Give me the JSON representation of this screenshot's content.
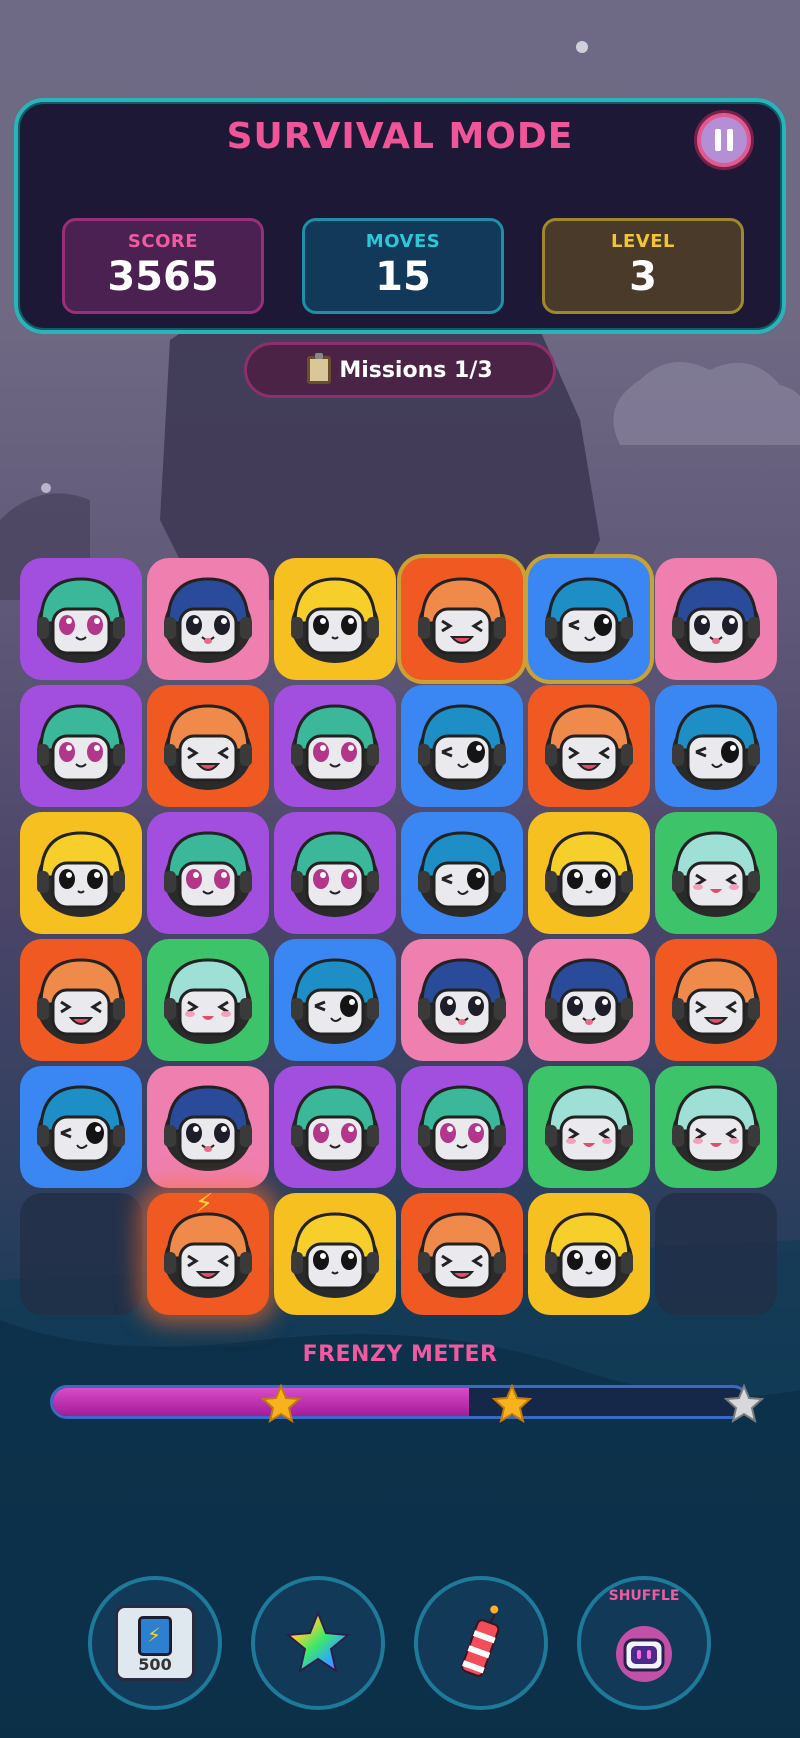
{
  "header": {
    "title": "SURVIVAL MODE",
    "pause_icon": "pause-icon"
  },
  "stats": {
    "score_label": "SCORE",
    "score_value": "3565",
    "moves_label": "MOVES",
    "moves_value": "15",
    "level_label": "LEVEL",
    "level_value": "3"
  },
  "missions": {
    "icon": "clipboard-icon",
    "label": "Missions 1/3"
  },
  "board": {
    "rows": 6,
    "cols": 6,
    "tile_colors": {
      "purple": "#a24fe0",
      "pink": "#ef7fae",
      "yellow": "#f6c020",
      "orange": "#f05a22",
      "blue": "#3a86f2",
      "green": "#3dc46a",
      "empty": "#2a3555"
    },
    "tiles": [
      [
        {
          "color": "purple",
          "face": "green-bolt"
        },
        {
          "color": "pink",
          "face": "navy-sparkle"
        },
        {
          "color": "yellow",
          "face": "yellow-cute"
        },
        {
          "color": "orange",
          "face": "orange-laugh",
          "state": "selected"
        },
        {
          "color": "blue",
          "face": "teal-wink",
          "state": "selected"
        },
        {
          "color": "pink",
          "face": "navy-sparkle"
        }
      ],
      [
        {
          "color": "purple",
          "face": "green-bolt"
        },
        {
          "color": "orange",
          "face": "orange-laugh"
        },
        {
          "color": "purple",
          "face": "green-bolt"
        },
        {
          "color": "blue",
          "face": "teal-wink"
        },
        {
          "color": "orange",
          "face": "orange-laugh"
        },
        {
          "color": "blue",
          "face": "teal-wink"
        }
      ],
      [
        {
          "color": "yellow",
          "face": "yellow-cute"
        },
        {
          "color": "purple",
          "face": "green-bolt"
        },
        {
          "color": "purple",
          "face": "green-bolt"
        },
        {
          "color": "blue",
          "face": "teal-wink"
        },
        {
          "color": "yellow",
          "face": "yellow-cute"
        },
        {
          "color": "green",
          "face": "mint-blush"
        }
      ],
      [
        {
          "color": "orange",
          "face": "orange-laugh"
        },
        {
          "color": "green",
          "face": "mint-blush"
        },
        {
          "color": "blue",
          "face": "teal-wink"
        },
        {
          "color": "pink",
          "face": "navy-sparkle"
        },
        {
          "color": "pink",
          "face": "navy-sparkle"
        },
        {
          "color": "orange",
          "face": "orange-laugh"
        }
      ],
      [
        {
          "color": "blue",
          "face": "teal-wink"
        },
        {
          "color": "pink",
          "face": "navy-sparkle"
        },
        {
          "color": "purple",
          "face": "green-bolt"
        },
        {
          "color": "purple",
          "face": "green-bolt"
        },
        {
          "color": "green",
          "face": "mint-blush"
        },
        {
          "color": "green",
          "face": "mint-blush"
        }
      ],
      [
        {
          "color": "empty",
          "face": "none"
        },
        {
          "color": "orange",
          "face": "orange-laugh",
          "state": "powered"
        },
        {
          "color": "yellow",
          "face": "yellow-cute"
        },
        {
          "color": "orange",
          "face": "orange-laugh"
        },
        {
          "color": "yellow",
          "face": "yellow-cute"
        },
        {
          "color": "empty",
          "face": "none"
        }
      ]
    ]
  },
  "frenzy": {
    "label": "FRENZY METER",
    "progress": 0.6,
    "stars": [
      {
        "at": 0.33,
        "achieved": true
      },
      {
        "at": 0.66,
        "achieved": true
      },
      {
        "at": 1.0,
        "achieved": false
      }
    ]
  },
  "boosters": [
    {
      "name": "battery-booster",
      "icon": "battery-icon",
      "label": "500"
    },
    {
      "name": "rainbow-star-booster",
      "icon": "rainbow-star-icon"
    },
    {
      "name": "firecracker-booster",
      "icon": "firecracker-icon"
    },
    {
      "name": "shuffle-booster",
      "icon": "shuffle-robot-icon",
      "label": "SHUFFLE"
    }
  ]
}
